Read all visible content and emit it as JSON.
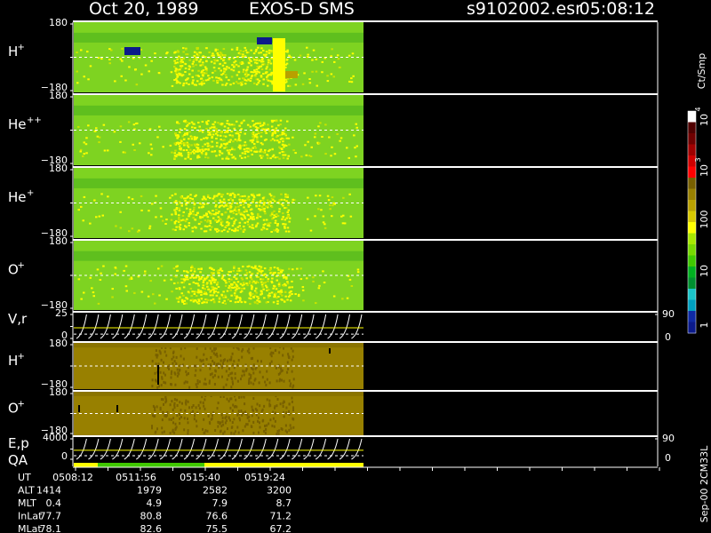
{
  "header": {
    "date": "Oct 20, 1989",
    "instrument": "EXOS-D SMS",
    "file": "s9102002.esr",
    "time": "05:08:12"
  },
  "footer_label": "Sep-00 2CM33L",
  "colorbar": {
    "unit": "Ct/Smp",
    "ticks": [
      "1",
      "10",
      "100",
      "10",
      "3",
      "10",
      "4"
    ],
    "colors": [
      "#0b1a8a",
      "#0f2aa3",
      "#00a0c0",
      "#1bc4c8",
      "#009030",
      "#00b020",
      "#40c800",
      "#78d800",
      "#a8e800",
      "#ffff00",
      "#d8c800",
      "#b8a000",
      "#988000",
      "#786000",
      "#ff0000",
      "#d00000",
      "#a00000",
      "#700000",
      "#500000",
      "#ffffff"
    ]
  },
  "panels": [
    {
      "id": "h-plus-1",
      "label": "H",
      "sup": "+",
      "ytop": "180",
      "ybot": "−180",
      "kind": "spec"
    },
    {
      "id": "he-pp",
      "label": "He",
      "sup": "++",
      "ytop": "180",
      "ybot": "−180",
      "kind": "spec"
    },
    {
      "id": "he-plus",
      "label": "He",
      "sup": "+",
      "ytop": "180",
      "ybot": "−180",
      "kind": "spec"
    },
    {
      "id": "o-plus-1",
      "label": "O",
      "sup": "+",
      "ytop": "180",
      "ybot": "−180",
      "kind": "spec"
    },
    {
      "id": "vr",
      "label": "V,r",
      "sup": "",
      "ytop": "25",
      "ybot": "0",
      "kind": "line",
      "rtop": "90",
      "rbot": "0"
    },
    {
      "id": "h-plus-2",
      "label": "H",
      "sup": "+",
      "ytop": "180",
      "ybot": "−180",
      "kind": "olive"
    },
    {
      "id": "o-plus-2",
      "label": "O",
      "sup": "+",
      "ytop": "180",
      "ybot": "−180",
      "kind": "olive"
    },
    {
      "id": "ep",
      "label": "E,p",
      "sup": "",
      "ytop": "4000",
      "ybot": "0",
      "kind": "line",
      "rtop": "90",
      "rbot": "0"
    }
  ],
  "qa_label": "QA",
  "ephemeris": {
    "rows": [
      {
        "name": "UT",
        "values": [
          "0508:12",
          "0511:56",
          "0515:40",
          "0519:24"
        ]
      },
      {
        "name": "ALT",
        "values": [
          "1414",
          "1979",
          "2582",
          "3200"
        ]
      },
      {
        "name": "MLT",
        "values": [
          "0.4",
          "4.9",
          "7.9",
          "8.7"
        ]
      },
      {
        "name": "InLat",
        "values": [
          "77.7",
          "80.8",
          "76.6",
          "71.2"
        ]
      },
      {
        "name": "MLat",
        "values": [
          "78.1",
          "82.6",
          "75.5",
          "67.2"
        ]
      }
    ]
  }
}
